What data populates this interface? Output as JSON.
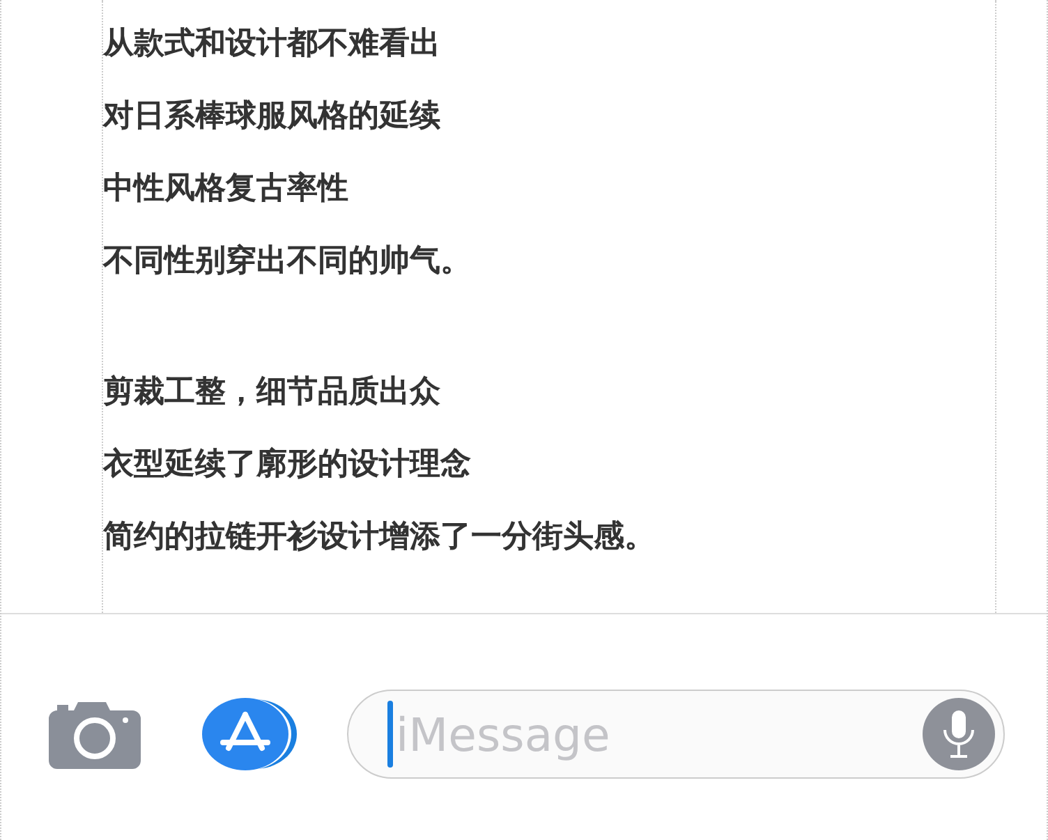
{
  "article": {
    "paragraphs": [
      {
        "lines": [
          "从款式和设计都不难看出",
          "对日系棒球服风格的延续",
          "中性风格复古率性",
          "不同性别穿出不同的帅气。"
        ]
      },
      {
        "lines": [
          "剪裁工整，细节品质出众",
          "衣型延续了廓形的设计理念",
          "简约的拉链开衫设计增添了一分街头感。"
        ]
      }
    ]
  },
  "compose_bar": {
    "message_field": {
      "placeholder": "iMessage"
    }
  }
}
